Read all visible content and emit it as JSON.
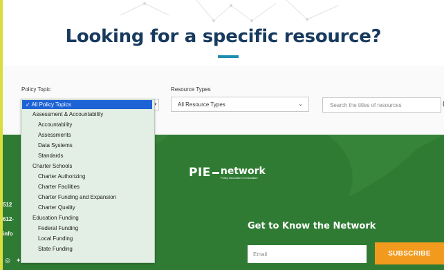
{
  "hero": {
    "title": "Looking for a specific resource?"
  },
  "filters": {
    "policy_topic_label": "Policy Topic",
    "resource_types_label": "Resource Types",
    "resource_types_value": "All Resource Types",
    "search_placeholder": "Search the titles of resources",
    "search_edge": "("
  },
  "policy_topic_menu": {
    "items": [
      {
        "label": "✓ All Policy Topics",
        "level": 0,
        "selected": true
      },
      {
        "label": "Assessment & Accountability",
        "level": 1
      },
      {
        "label": "Accountability",
        "level": 2
      },
      {
        "label": "Assessments",
        "level": 2
      },
      {
        "label": "Data Systems",
        "level": 2
      },
      {
        "label": "Standards",
        "level": 2
      },
      {
        "label": "Charter Schools",
        "level": 1
      },
      {
        "label": "Charter Authorizing",
        "level": 2
      },
      {
        "label": "Charter Facilities",
        "level": 2
      },
      {
        "label": "Charter Funding and Expansion",
        "level": 2
      },
      {
        "label": "Charter Quality",
        "level": 2
      },
      {
        "label": "Education Funding",
        "level": 1
      },
      {
        "label": "Federal Funding",
        "level": 2
      },
      {
        "label": "Local Funding",
        "level": 2
      },
      {
        "label": "State Funding",
        "level": 2
      }
    ]
  },
  "footer": {
    "logo": {
      "pie": "PIE",
      "network": "network",
      "tagline": "Policy Innovators in Education"
    },
    "contact_lines": [
      "512",
      "612-",
      "info"
    ],
    "signup_heading": "Get to Know the Network",
    "email_placeholder": "Email",
    "subscribe_label": "SUBSCRIBE",
    "social_icons": [
      "instagram-icon",
      "twitter-icon",
      "linkedin-icon"
    ]
  },
  "colors": {
    "border_yellow": "#d8de3e",
    "title_navy": "#173a5e",
    "accent_blue": "#1f8fb0",
    "footer_green": "#2f7b33",
    "subscribe_orange": "#f29a1d",
    "selected_blue": "#1e63d6"
  }
}
